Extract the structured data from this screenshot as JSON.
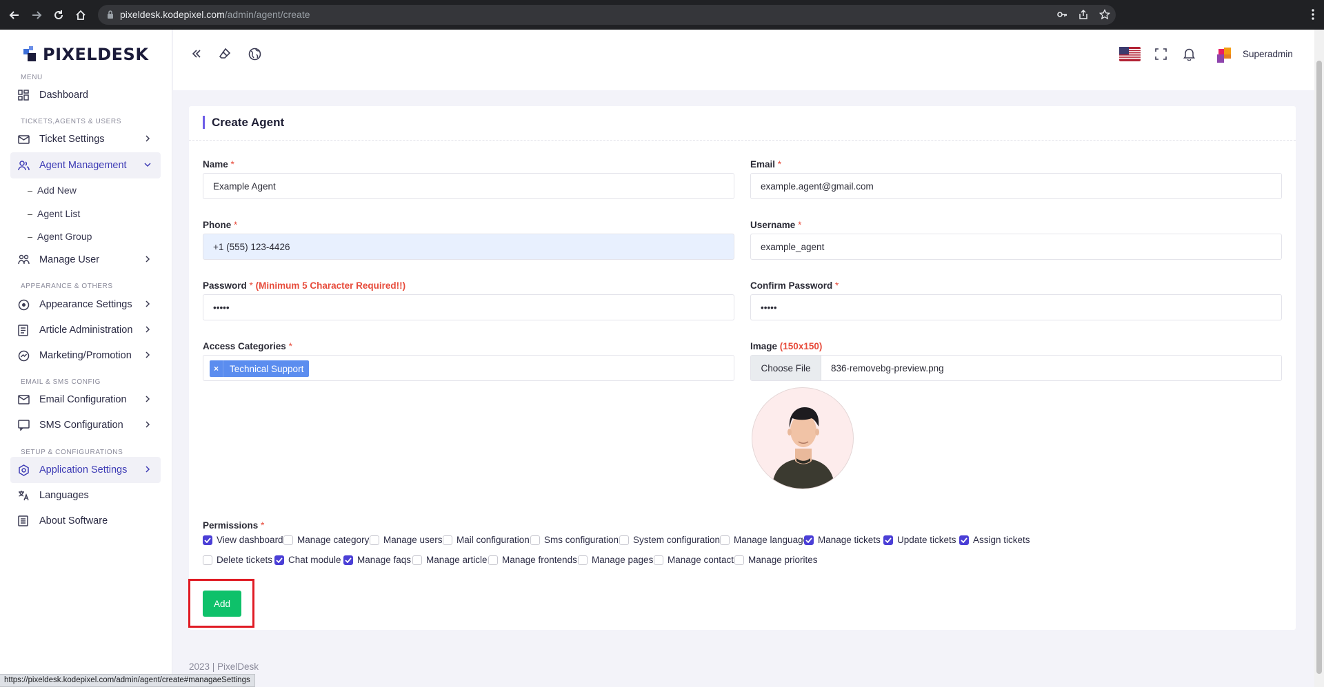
{
  "browser": {
    "url_host": "pixeldesk.kodepixel.com",
    "url_path": "/admin/agent/create",
    "status_url": "https://pixeldesk.kodepixel.com/admin/agent/create#managaeSettings"
  },
  "brand": {
    "name": "PIXELDESK"
  },
  "sidebar": {
    "headings": {
      "menu": "MENU",
      "tickets": "TICKETS,AGENTS & USERS",
      "appearance": "APPEARANCE & OTHERS",
      "email": "EMAIL & SMS CONFIG",
      "setup": "SETUP & CONFIGURATIONS"
    },
    "items": {
      "dashboard": "Dashboard",
      "ticket_settings": "Ticket Settings",
      "agent_management": "Agent Management",
      "add_new": "Add New",
      "agent_list": "Agent List",
      "agent_group": "Agent Group",
      "manage_user": "Manage User",
      "appearance_settings": "Appearance Settings",
      "article_administration": "Article Administration",
      "marketing_promotion": "Marketing/Promotion",
      "email_configuration": "Email Configuration",
      "sms_configuration": "SMS Configuration",
      "application_settings": "Application Settings",
      "languages": "Languages",
      "about_software": "About Software"
    }
  },
  "topbar": {
    "user_name": "Superadmin"
  },
  "form": {
    "title": "Create Agent",
    "name": {
      "label": "Name",
      "value": "Example Agent"
    },
    "email": {
      "label": "Email",
      "value": "example.agent@gmail.com"
    },
    "phone": {
      "label": "Phone",
      "value": "+1 (555) 123-4426"
    },
    "username": {
      "label": "Username",
      "value": "example_agent"
    },
    "password": {
      "label": "Password",
      "hint": "(Minimum 5 Character Required!!)",
      "value": "•••••"
    },
    "confirm_password": {
      "label": "Confirm Password",
      "value": "•••••"
    },
    "access_categories": {
      "label": "Access Categories",
      "tag": "Technical Support",
      "remove": "×"
    },
    "image": {
      "label": "Image",
      "hint": "(150x150)",
      "button": "Choose File",
      "filename": "836-removebg-preview.png"
    },
    "required_mark": "*",
    "permissions_label": "Permissions",
    "permissions": [
      {
        "label": "View dashboard",
        "checked": true
      },
      {
        "label": "Manage category",
        "checked": false
      },
      {
        "label": "Manage users",
        "checked": false
      },
      {
        "label": "Mail configuration",
        "checked": false
      },
      {
        "label": "Sms configuration",
        "checked": false
      },
      {
        "label": "System configuration",
        "checked": false
      },
      {
        "label": "Manage language",
        "checked": false
      },
      {
        "label": "Manage tickets",
        "checked": true
      },
      {
        "label": "Update tickets",
        "checked": true
      },
      {
        "label": "Assign tickets",
        "checked": true
      },
      {
        "label": "Delete tickets",
        "checked": false
      },
      {
        "label": "Chat module",
        "checked": true
      },
      {
        "label": "Manage faqs",
        "checked": true
      },
      {
        "label": "Manage article",
        "checked": false
      },
      {
        "label": "Manage frontends",
        "checked": false
      },
      {
        "label": "Manage pages",
        "checked": false
      },
      {
        "label": "Manage contact",
        "checked": false
      },
      {
        "label": "Manage priorites",
        "checked": false
      }
    ],
    "add_button": "Add"
  },
  "footer": {
    "text": "2023 | PixelDesk"
  },
  "colors": {
    "accent": "#4b3fd6",
    "success": "#0ec16a",
    "danger": "#e74c3c",
    "tag": "#5b8def"
  }
}
